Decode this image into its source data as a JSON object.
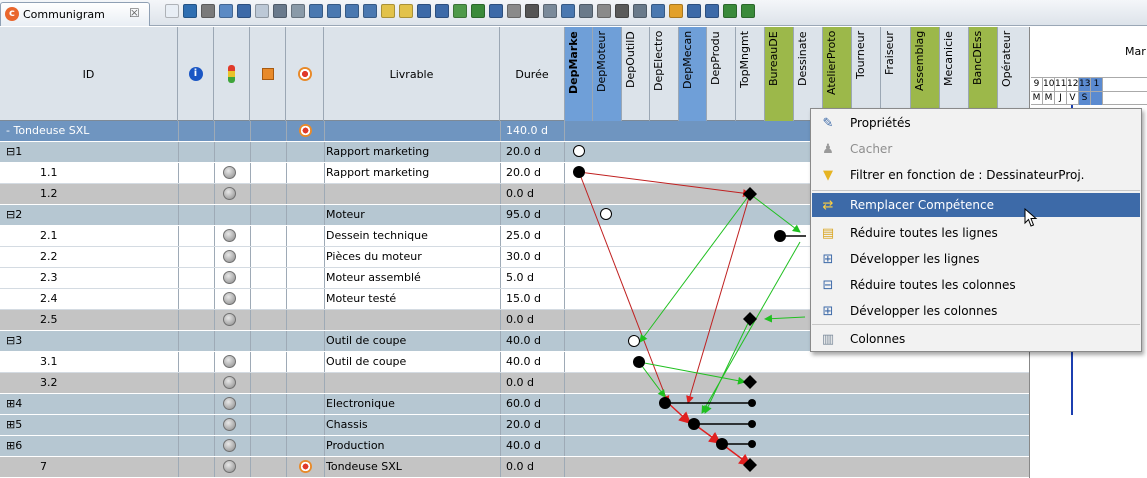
{
  "tab": {
    "title": "Communigram",
    "close": "☒"
  },
  "headers": {
    "id": "ID",
    "livrable": "Livrable",
    "duree": "Durée",
    "resources": [
      "DepMarke",
      "DepMoteur",
      "DepOutilD",
      "DepElectro",
      "DepMecan",
      "DepProdu",
      "TopMngmt",
      "BureauDE",
      "Dessinate",
      "AtelierProto",
      "Tourneur",
      "Fraiseur",
      "Assemblag",
      "Mecanicie",
      "BancDEss",
      "Opérateur"
    ]
  },
  "rows": [
    {
      "id": "- Tondeuse SXL",
      "livrable": "",
      "duree": "140.0 d",
      "kind": "top"
    },
    {
      "id": "⊟1",
      "livrable": "Rapport marketing",
      "duree": "20.0 d",
      "kind": "summary"
    },
    {
      "id": "1.1",
      "livrable": "Rapport marketing",
      "duree": "20.0 d",
      "kind": "task"
    },
    {
      "id": "1.2",
      "livrable": "",
      "duree": "0.0 d",
      "kind": "milestone"
    },
    {
      "id": "⊟2",
      "livrable": "Moteur",
      "duree": "95.0 d",
      "kind": "summary"
    },
    {
      "id": "2.1",
      "livrable": "Dessein technique",
      "duree": "25.0 d",
      "kind": "task"
    },
    {
      "id": "2.2",
      "livrable": "Pièces du moteur",
      "duree": "30.0 d",
      "kind": "task"
    },
    {
      "id": "2.3",
      "livrable": "Moteur assemblé",
      "duree": "5.0 d",
      "kind": "task"
    },
    {
      "id": "2.4",
      "livrable": "Moteur testé",
      "duree": "15.0 d",
      "kind": "task"
    },
    {
      "id": "2.5",
      "livrable": "",
      "duree": "0.0 d",
      "kind": "milestone"
    },
    {
      "id": "⊟3",
      "livrable": "Outil de coupe",
      "duree": "40.0 d",
      "kind": "summary"
    },
    {
      "id": "3.1",
      "livrable": "Outil de coupe",
      "duree": "40.0 d",
      "kind": "task"
    },
    {
      "id": "3.2",
      "livrable": "",
      "duree": "0.0 d",
      "kind": "milestone"
    },
    {
      "id": "⊞4",
      "livrable": "Electronique",
      "duree": "60.0 d",
      "kind": "summary"
    },
    {
      "id": "⊞5",
      "livrable": "Chassis",
      "duree": "20.0 d",
      "kind": "summary"
    },
    {
      "id": "⊞6",
      "livrable": "Production",
      "duree": "40.0 d",
      "kind": "summary"
    },
    {
      "id": "7",
      "livrable": "Tondeuse SXL",
      "duree": "0.0 d",
      "kind": "milestone"
    }
  ],
  "timeline": {
    "month": "Mar",
    "days": [
      "9",
      "10",
      "11",
      "12",
      "13",
      "1"
    ],
    "weekdays": [
      "M",
      "M",
      "J",
      "V",
      "S",
      ""
    ]
  },
  "menu": {
    "items": [
      {
        "label": "Propriétés",
        "icon": "properties-icon",
        "disabled": false,
        "selected": false
      },
      {
        "label": "Cacher",
        "icon": "hide-icon",
        "disabled": true,
        "selected": false
      },
      {
        "label": "Filtrer en fonction de  : DessinateurProj.",
        "icon": "filter-icon",
        "disabled": false,
        "selected": false
      },
      {
        "label": "Remplacer Compétence",
        "icon": "replace-skill-icon",
        "disabled": false,
        "selected": true
      },
      {
        "label": "Réduire toutes les lignes",
        "icon": "collapse-rows-icon",
        "disabled": false,
        "selected": false
      },
      {
        "label": "Développer les lignes",
        "icon": "expand-rows-icon",
        "disabled": false,
        "selected": false
      },
      {
        "label": "Réduire toutes les colonnes",
        "icon": "collapse-columns-icon",
        "disabled": false,
        "selected": false
      },
      {
        "label": "Développer les colonnes",
        "icon": "expand-columns-icon",
        "disabled": false,
        "selected": false
      },
      {
        "label": "Colonnes",
        "icon": "columns-icon",
        "disabled": false,
        "selected": false
      }
    ]
  },
  "colors": {
    "blue_col": "#6f9fd8",
    "green_col": "#9cb84a",
    "selected": "#3d6aa8"
  }
}
